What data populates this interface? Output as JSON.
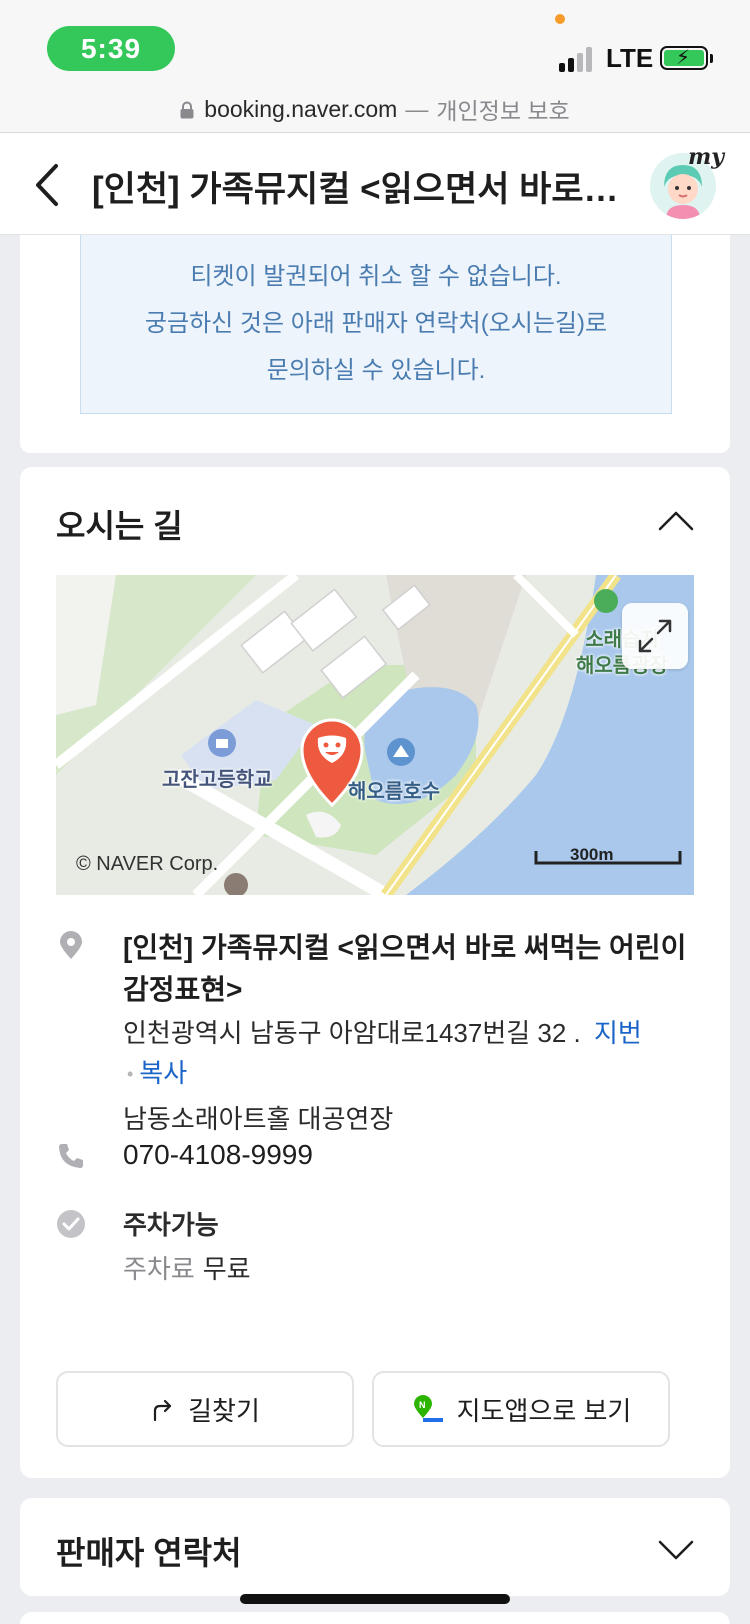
{
  "status_bar": {
    "time": "5:39",
    "network": "LTE"
  },
  "browser": {
    "domain": "booking.naver.com",
    "separator": "—",
    "privacy": "개인정보 보호"
  },
  "header": {
    "title": "[인천] 가족뮤지컬 <읽으면서 바로 써먹는 어린이 감정표현>",
    "avatar_badge": "my"
  },
  "notice": {
    "lines": [
      "티켓이 발권되어 취소 할 수 없습니다.",
      "궁금하신 것은 아래 판매자 연락처(오시는길)로",
      "문의하실 수 있습니다."
    ]
  },
  "directions": {
    "title": "오시는 길",
    "map": {
      "copyright": "© NAVER Corp.",
      "scale": "300m",
      "labels": {
        "school": "고잔고등학교",
        "lake": "해오름호수",
        "park": "소래습지\n해오름광장"
      }
    },
    "venue_name": "[인천] 가족뮤지컬 <읽으면서 바로 써먹는 어린이 감정표현>",
    "address": "인천광역시 남동구 아암대로1437번길 32 .",
    "address_links": {
      "jibun": "지번",
      "copy": "복사"
    },
    "place": "남동소래아트홀 대공연장",
    "phone": "070-4108-9999",
    "parking": {
      "title": "주차가능",
      "fee_label": "주차료",
      "fee_value": "무료"
    },
    "buttons": {
      "route": "길찾기",
      "map_app": "지도앱으로 보기"
    }
  },
  "seller": {
    "title": "판매자 연락처"
  },
  "colors": {
    "accent_link": "#1b64c8",
    "notice_text": "#4a7cb0",
    "status_green": "#34c759",
    "marker_red": "#ee5a3f"
  }
}
